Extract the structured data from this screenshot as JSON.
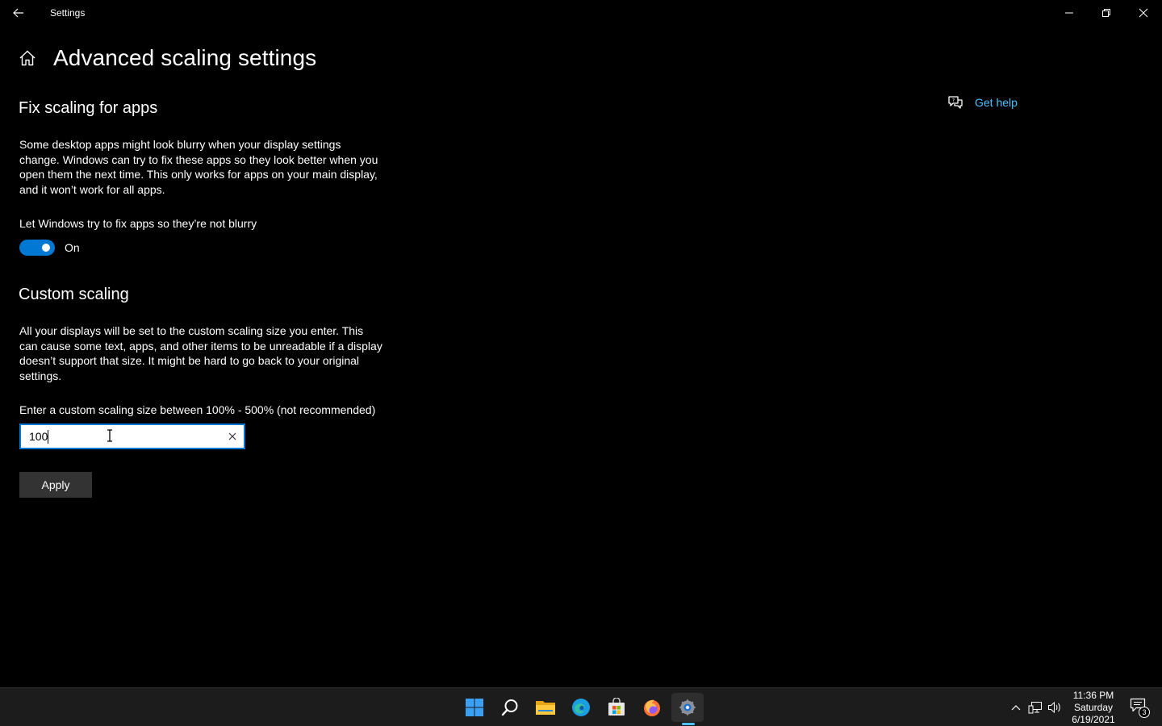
{
  "window": {
    "title": "Settings"
  },
  "page": {
    "title": "Advanced scaling settings"
  },
  "help": {
    "label": "Get help"
  },
  "fix_scaling": {
    "heading": "Fix scaling for apps",
    "description": "Some desktop apps might look blurry when your display settings change. Windows can try to fix these apps so they look better when you open them the next time. This only works for apps on your main display, and it won’t work for all apps.",
    "toggle_label": "Let Windows try to fix apps so they’re not blurry",
    "toggle_state": "On",
    "toggle_on": true
  },
  "custom_scaling": {
    "heading": "Custom scaling",
    "description": "All your displays will be set to the custom scaling size you enter. This can cause some text, apps, and other items to be unreadable if a display doesn’t support that size. It might be hard to go back to your original settings.",
    "input_label": "Enter a custom scaling size between 100% - 500% (not recommended)",
    "input_value": "100",
    "apply_label": "Apply"
  },
  "taskbar": {
    "apps": [
      "start-icon",
      "search-icon",
      "file-explorer-icon",
      "edge-icon",
      "store-icon",
      "firefox-icon",
      "settings-icon"
    ],
    "active_app": "settings-icon",
    "clock": {
      "time": "11:36 PM",
      "day": "Saturday",
      "date": "6/19/2021"
    },
    "notification_count": "3"
  },
  "colors": {
    "accent": "#0078d4",
    "link": "#4cc2ff",
    "background": "#000000",
    "taskbar": "#1c1c1c"
  }
}
